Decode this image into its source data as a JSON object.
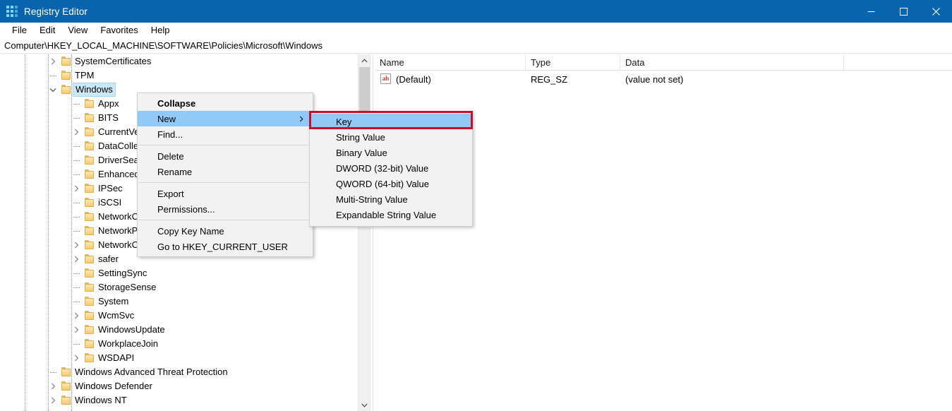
{
  "window": {
    "title": "Registry Editor",
    "icon": "registry-editor-icon",
    "controls": {
      "minimize": "Minimize",
      "maximize": "Maximize",
      "close": "Close"
    },
    "titlebar_color": "#0a64ad"
  },
  "menubar": {
    "items": [
      {
        "label": "File"
      },
      {
        "label": "Edit"
      },
      {
        "label": "View"
      },
      {
        "label": "Favorites"
      },
      {
        "label": "Help"
      }
    ]
  },
  "address": {
    "path": "Computer\\HKEY_LOCAL_MACHINE\\SOFTWARE\\Policies\\Microsoft\\Windows"
  },
  "tree": {
    "selected": "Windows",
    "items": [
      {
        "label": "SystemCertificates",
        "depth": 3,
        "expandable": true,
        "expanded": false,
        "selected": false
      },
      {
        "label": "TPM",
        "depth": 3,
        "expandable": false,
        "expanded": false,
        "selected": false
      },
      {
        "label": "Windows",
        "depth": 3,
        "expandable": true,
        "expanded": true,
        "selected": true
      },
      {
        "label": "Appx",
        "depth": 4,
        "expandable": false,
        "expanded": false,
        "selected": false
      },
      {
        "label": "BITS",
        "depth": 4,
        "expandable": false,
        "expanded": false,
        "selected": false
      },
      {
        "label": "CurrentVersion",
        "depth": 4,
        "expandable": true,
        "expanded": false,
        "selected": false
      },
      {
        "label": "DataCollection",
        "depth": 4,
        "expandable": false,
        "expanded": false,
        "selected": false
      },
      {
        "label": "DriverSearching",
        "depth": 4,
        "expandable": false,
        "expanded": false,
        "selected": false
      },
      {
        "label": "EnhancedStorageDevices",
        "depth": 4,
        "expandable": false,
        "expanded": false,
        "selected": false
      },
      {
        "label": "IPSec",
        "depth": 4,
        "expandable": true,
        "expanded": false,
        "selected": false
      },
      {
        "label": "iSCSI",
        "depth": 4,
        "expandable": false,
        "expanded": false,
        "selected": false
      },
      {
        "label": "NetworkConnections",
        "depth": 4,
        "expandable": false,
        "expanded": false,
        "selected": false
      },
      {
        "label": "NetworkProvider",
        "depth": 4,
        "expandable": false,
        "expanded": false,
        "selected": false
      },
      {
        "label": "NetworkConnectivityStatusIndicator",
        "depth": 4,
        "expandable": true,
        "expanded": false,
        "selected": false
      },
      {
        "label": "safer",
        "depth": 4,
        "expandable": true,
        "expanded": false,
        "selected": false
      },
      {
        "label": "SettingSync",
        "depth": 4,
        "expandable": false,
        "expanded": false,
        "selected": false
      },
      {
        "label": "StorageSense",
        "depth": 4,
        "expandable": false,
        "expanded": false,
        "selected": false
      },
      {
        "label": "System",
        "depth": 4,
        "expandable": false,
        "expanded": false,
        "selected": false
      },
      {
        "label": "WcmSvc",
        "depth": 4,
        "expandable": true,
        "expanded": false,
        "selected": false
      },
      {
        "label": "WindowsUpdate",
        "depth": 4,
        "expandable": true,
        "expanded": false,
        "selected": false
      },
      {
        "label": "WorkplaceJoin",
        "depth": 4,
        "expandable": false,
        "expanded": false,
        "selected": false
      },
      {
        "label": "WSDAPI",
        "depth": 4,
        "expandable": true,
        "expanded": false,
        "selected": false
      },
      {
        "label": "Windows Advanced Threat Protection",
        "depth": 3,
        "expandable": false,
        "expanded": false,
        "selected": false
      },
      {
        "label": "Windows Defender",
        "depth": 3,
        "expandable": true,
        "expanded": false,
        "selected": false
      },
      {
        "label": "Windows NT",
        "depth": 3,
        "expandable": true,
        "expanded": false,
        "selected": false
      }
    ]
  },
  "list": {
    "columns": [
      {
        "label": "Name"
      },
      {
        "label": "Type"
      },
      {
        "label": "Data"
      }
    ],
    "rows": [
      {
        "name": "(Default)",
        "type": "REG_SZ",
        "data": "(value not set)",
        "icon": "string-value-icon"
      }
    ]
  },
  "context_menu": {
    "items": [
      {
        "label": "Collapse",
        "bold": true,
        "highlighted": false,
        "submenu": false
      },
      {
        "label": "New",
        "bold": false,
        "highlighted": true,
        "submenu": true
      },
      {
        "label": "Find...",
        "bold": false,
        "highlighted": false,
        "submenu": false
      },
      {
        "separator": true
      },
      {
        "label": "Delete",
        "bold": false,
        "highlighted": false,
        "submenu": false
      },
      {
        "label": "Rename",
        "bold": false,
        "highlighted": false,
        "submenu": false
      },
      {
        "separator": true
      },
      {
        "label": "Export",
        "bold": false,
        "highlighted": false,
        "submenu": false
      },
      {
        "label": "Permissions...",
        "bold": false,
        "highlighted": false,
        "submenu": false
      },
      {
        "separator": true
      },
      {
        "label": "Copy Key Name",
        "bold": false,
        "highlighted": false,
        "submenu": false
      },
      {
        "label": "Go to HKEY_CURRENT_USER",
        "bold": false,
        "highlighted": false,
        "submenu": false
      }
    ]
  },
  "submenu": {
    "items": [
      {
        "label": "Key",
        "highlighted": true
      },
      {
        "label": "String Value",
        "highlighted": false
      },
      {
        "label": "Binary Value",
        "highlighted": false
      },
      {
        "label": "DWORD (32-bit) Value",
        "highlighted": false
      },
      {
        "label": "QWORD (64-bit) Value",
        "highlighted": false
      },
      {
        "label": "Multi-String Value",
        "highlighted": false
      },
      {
        "label": "Expandable String Value",
        "highlighted": false
      }
    ]
  },
  "annotation": {
    "target": "Key",
    "color": "#c8102e"
  },
  "scrollbar": {
    "up_arrow": "scroll-up",
    "down_arrow": "scroll-down"
  }
}
